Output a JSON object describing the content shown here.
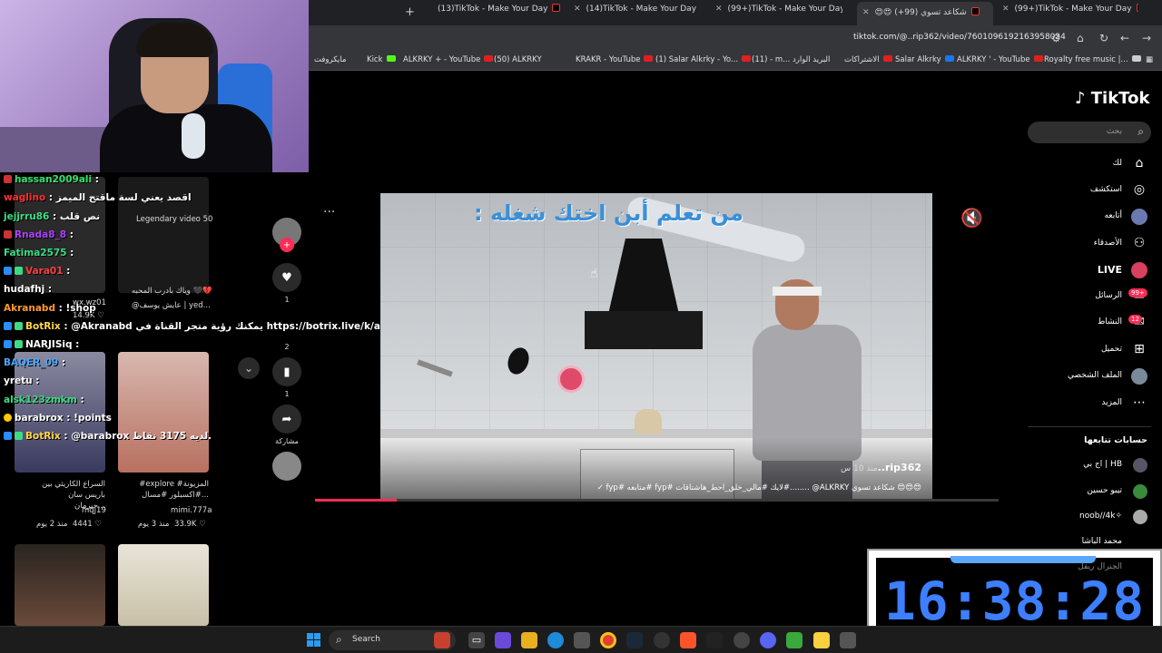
{
  "browser": {
    "tabs": [
      {
        "title": "(13)TikTok - Make Your Day"
      },
      {
        "title": "(14)TikTok - Make Your Day"
      },
      {
        "title": "(99+)TikTok - Make Your Day"
      },
      {
        "title": "😍😍 شكاعد تسوي (99+)"
      },
      {
        "title": "(99+)TikTok - Make Your Day"
      }
    ],
    "url": "tiktok.com/@..rip362/video/7601096192163958024",
    "bookmarks": [
      "مايكروفت",
      "Kick",
      "ALKRKY + - YouTube",
      "(50) ALKRKY",
      "KRAKR - YouTube",
      "(1) Salar Alkrky - Yo...",
      "(11) - m... البريد الوارد",
      "الاشتراكات",
      "Salar Alkrky",
      "ALKRKY ' - YouTube",
      "Royalty free music |..."
    ]
  },
  "chat": {
    "lines": [
      {
        "user": "hassan2009ali",
        "color": "#33e06a",
        "msg": ""
      },
      {
        "user": "waglino",
        "color": "#ff3030",
        "msg": "اقصد يعني لسة ماقتح الميمز"
      },
      {
        "user": "jejjrru86",
        "color": "#3ddc84",
        "msg": "نص قلب"
      },
      {
        "user": "Rnada8_8",
        "color": "#b040ff",
        "msg": ""
      },
      {
        "user": "Fatima2575",
        "color": "#3ddc84",
        "msg": ""
      },
      {
        "user": "Vara01",
        "color": "#ff4040",
        "msg": ""
      },
      {
        "user": "hudafhj",
        "color": "#ffffff",
        "msg": ""
      },
      {
        "user": "Akranabd",
        "color": "#ff9a2a",
        "msg": "!shop"
      },
      {
        "user": "BotRix",
        "color": "#ffd54a",
        "msg": "@Akranabd يمكنك رؤية متجر القناة في https://botrix.live/k/alkrky99/shop"
      },
      {
        "user": "NARJISiq",
        "color": "#ffffff",
        "msg": ""
      },
      {
        "user": "BAQER_09",
        "color": "#4aa8ff",
        "msg": ""
      },
      {
        "user": "yretu",
        "color": "#ffffff",
        "msg": ""
      },
      {
        "user": "alsk123zmkm",
        "color": "#3ddc84",
        "msg": ""
      },
      {
        "user": "barabrox",
        "color": "#ffffff",
        "msg": "!points"
      },
      {
        "user": "BotRix",
        "color": "#ffd54a",
        "msg": "@barabrox لديه 3175 نقاط."
      }
    ]
  },
  "left_feed": {
    "thumb_labels": [
      "Legendary video 50",
      "وياك بادرب المحبه 🖤💔",
      "@عايش يوسف | yed...",
      "wx.wz01",
      "14.9K ♡"
    ],
    "cards": [
      {
        "desc": "السراع الكاريثي بين باريس سان جيرمان...",
        "author": "mqj19",
        "date": "منذ 2 يوم",
        "likes": "4441 ♡"
      },
      {
        "desc": "#explore المزيونة# #اكسبلور #مسال...",
        "author": "mimi.777a",
        "date": "منذ 3 يوم",
        "likes": "33.9K ♡"
      }
    ]
  },
  "actions": {
    "like_count": "1",
    "comment_count": "2",
    "save_count": "1",
    "share_label": "مشاركة"
  },
  "video": {
    "caption": "من تعلم أبن اختك شغله :",
    "author": "rip362..",
    "ago": "منذ 10 س",
    "description": "😍😍😍 شكاعد تسوي ALKRKY@ ........#لايك #مالي_خلق_احط_هاشتاقات #fyp #متابعه #fyp ✓",
    "progress": 0.12
  },
  "tiktok": {
    "logo": "TikTok",
    "search_placeholder": "بحث",
    "nav": [
      {
        "label": "لك",
        "icon": "home-icon"
      },
      {
        "label": "استكشف",
        "icon": "compass-icon"
      },
      {
        "label": "أتابعه",
        "icon": "avatar-icon"
      },
      {
        "label": "الأصدقاء",
        "icon": "friends-icon"
      },
      {
        "label": "LIVE",
        "icon": "live-icon"
      },
      {
        "label": "الرسائل",
        "icon": "messages-icon",
        "badge": "99+"
      },
      {
        "label": "النشاط",
        "icon": "activity-icon",
        "badge": "12"
      },
      {
        "label": "تحميل",
        "icon": "upload-icon"
      },
      {
        "label": "الملف الشخصي",
        "icon": "profile-icon"
      },
      {
        "label": "المزيد",
        "icon": "more-icon"
      }
    ],
    "following_header": "حسابات تتابعها",
    "following": [
      {
        "name": "اج بي | HB"
      },
      {
        "name": "تيبو حسين"
      },
      {
        "name": "noob//4k✧"
      },
      {
        "name": "محمد الباشا"
      },
      {
        "name": "الجنرال ريفل"
      }
    ]
  },
  "clock": {
    "time": "16:38:28"
  },
  "taskbar": {
    "search_label": "Search"
  }
}
